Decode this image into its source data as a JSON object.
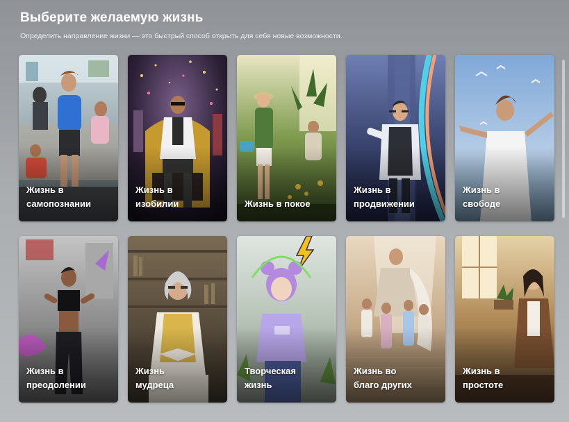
{
  "header": {
    "title": "Выберите желаемую жизнь",
    "subtitle": "Определить направление жизни — это быстрый способ открыть для себя новые возможности."
  },
  "cards": [
    {
      "label": "Жизнь в\nсамопознании",
      "icon": "man-running-gym"
    },
    {
      "label": "Жизнь в\nизобилии",
      "icon": "man-on-golden-throne"
    },
    {
      "label": "Жизнь в покое",
      "icon": "woman-gardening"
    },
    {
      "label": "Жизнь в\nпродвижении",
      "icon": "businessman-city"
    },
    {
      "label": "Жизнь в\nсвободе",
      "icon": "man-arms-open-sky"
    },
    {
      "label": "Жизнь в\nпреодолении",
      "icon": "athlete-woman"
    },
    {
      "label": "Жизнь\nмудреца",
      "icon": "old-man-reading"
    },
    {
      "label": "Творческая\nжизнь",
      "icon": "girl-purple-hair"
    },
    {
      "label": "Жизнь во\nблаго других",
      "icon": "man-with-children"
    },
    {
      "label": "Жизнь в\nпростоте",
      "icon": "woman-cozy-room"
    }
  ],
  "colors": {
    "background": "#a3a7ab",
    "text": "#ffffff"
  }
}
